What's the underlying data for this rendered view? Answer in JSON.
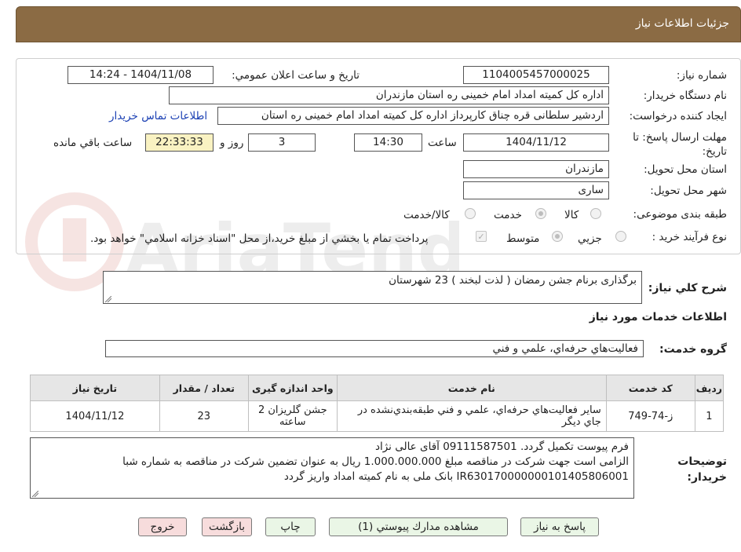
{
  "header": {
    "title": "جزئیات اطلاعات نیاز"
  },
  "watermark": {
    "text": "AriaTender.neT"
  },
  "fields": {
    "need_number_label": "شماره نیاز:",
    "need_number": "1104005457000025",
    "announce_label": "تاریخ و ساعت اعلان عمومي:",
    "announce_value": "1404/11/08 - 14:24",
    "buyer_org_label": "نام دستگاه خريدار:",
    "buyer_org": "اداره کل کمیته امداد امام خمینی  ره  استان مازندران",
    "requester_label": "ايجاد كننده درخواست:",
    "requester": "اردشیر سلطانی قره چناق کارپرداز اداره کل کمیته امداد امام خمینی  ره  استان",
    "contact_link": "اطلاعات تماس خريدار",
    "deadline_label": "مهلت ارسال پاسخ: تا تاريخ:",
    "deadline_date": "1404/11/12",
    "time_label": "ساعت",
    "deadline_time": "14:30",
    "days_value": "3",
    "days_label": "روز و",
    "remaining_time": "22:33:33",
    "remaining_label": "ساعت باقي مانده",
    "province_label": "استان محل تحويل:",
    "province": "مازندران",
    "city_label": "شهر محل تحويل:",
    "city": "ساری",
    "category_label": "طبقه بندی موضوعی:",
    "category_options": [
      "كالا",
      "خدمت",
      "كالا/خدمت"
    ],
    "process_label": "نوع فرآيند خريد :",
    "process_options": [
      "جزيي",
      "متوسط"
    ],
    "payment_note": "پرداخت تمام يا بخشي از مبلغ خريد،از محل \"اسناد خزانه اسلامي\" خواهد بود."
  },
  "description": {
    "label": "شرح كلي نياز:",
    "text": "برگذاری برنام جشن رمضان ( لذت لبخند ) 23 شهرستان"
  },
  "services": {
    "section_title": "اطلاعات خدمات مورد نياز",
    "group_label": "گروه خدمت:",
    "group_value": "فعاليت‌هاي حرفه‌اي، علمي و فني",
    "columns": [
      "رديف",
      "كد خدمت",
      "نام خدمت",
      "واحد اندازه گيری",
      "تعداد / مقدار",
      "تاريخ نياز"
    ],
    "rows": [
      [
        "1",
        "ز-74-749",
        "ساير فعاليت‌هاي حرفه‌اي، علمي و فني طبقه‌بندي‌نشده در جاي ديگر",
        "جشن گلریزان 2 ساعته",
        "23",
        "1404/11/12"
      ]
    ]
  },
  "buyer_notes": {
    "label": "توضيحات خريدار:",
    "lines": [
      "فرم پیوست تکمیل گردد. 09111587501 آقای عالی نژاد",
      "الزامی است جهت شرکت در مناقصه مبلغ 1.000.000.000 ریال به عنوان تضمین شرکت در مناقصه به شماره شبا",
      "IR630170000000101405806001 بانک ملی به نام کمیته امداد واریز گردد"
    ]
  },
  "buttons": {
    "reply": "پاسخ به نياز",
    "attachments": "مشاهده مدارك پيوستي (1)",
    "print": "چاپ",
    "back": "بازگشت",
    "exit": "خروج"
  },
  "colors": {
    "header_bg": "#8b6b44",
    "remaining_bg": "#f9f2c2",
    "link": "#1a3fb3"
  }
}
